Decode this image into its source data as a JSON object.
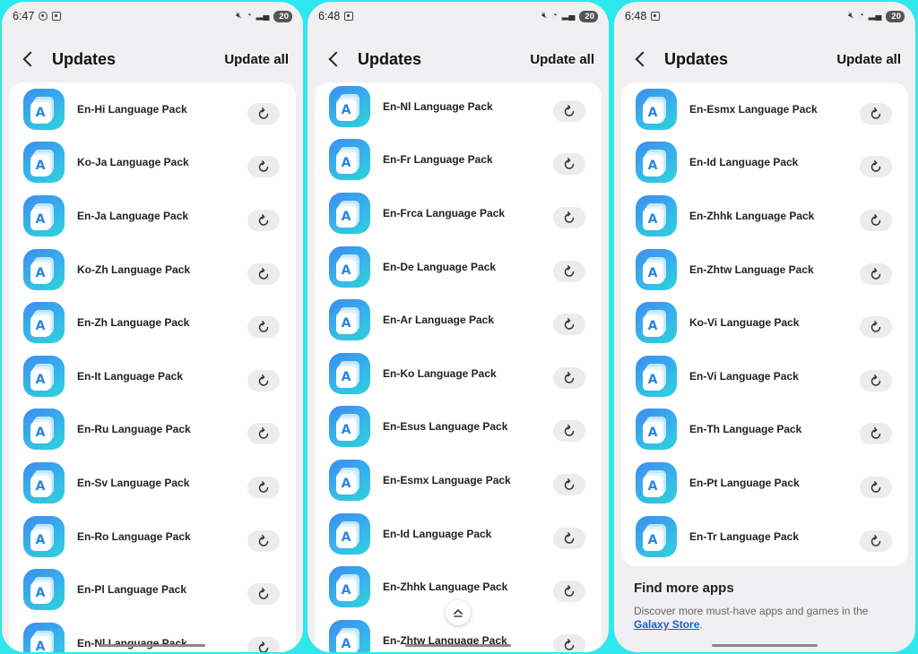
{
  "phones": [
    {
      "status": {
        "time": "6:47",
        "battery": "20"
      },
      "header": {
        "title": "Updates",
        "update_all": "Update all"
      },
      "items": [
        "En-Hi Language Pack",
        "Ko-Ja Language Pack",
        "En-Ja Language Pack",
        "Ko-Zh Language Pack",
        "En-Zh Language Pack",
        "En-It Language Pack",
        "En-Ru Language Pack",
        "En-Sv Language Pack",
        "En-Ro Language Pack",
        "En-Pl Language Pack",
        "En-Nl Language Pack"
      ]
    },
    {
      "status": {
        "time": "6:48",
        "battery": "20"
      },
      "header": {
        "title": "Updates",
        "update_all": "Update all"
      },
      "items": [
        "En-Nl Language Pack",
        "En-Fr Language Pack",
        "En-Frca Language Pack",
        "En-De Language Pack",
        "En-Ar Language Pack",
        "En-Ko Language Pack",
        "En-Esus Language Pack",
        "En-Esmx Language Pack",
        "En-Id Language Pack",
        "En-Zhhk Language Pack",
        "En-Zhtw Language Pack"
      ]
    },
    {
      "status": {
        "time": "6:48",
        "battery": "20"
      },
      "header": {
        "title": "Updates",
        "update_all": "Update all"
      },
      "items": [
        "En-Esmx Language Pack",
        "En-Id Language Pack",
        "En-Zhhk Language Pack",
        "En-Zhtw Language Pack",
        "Ko-Vi Language Pack",
        "En-Vi Language Pack",
        "En-Th Language Pack",
        "En-Pt Language Pack",
        "En-Tr Language Pack"
      ],
      "find_more": {
        "title": "Find more apps",
        "text": "Discover more must-have apps and games in the",
        "link": "Galaxy Store",
        "suffix": "."
      }
    }
  ],
  "app_icon_letter": "A",
  "colors": {
    "background": "#2ee8ee",
    "link": "#1a5fd0",
    "icon_start": "#3e8cf0",
    "icon_end": "#2ed3d7"
  },
  "icons": {
    "back": "chevron-left-icon",
    "update": "refresh-icon",
    "scroll_top": "chevron-up-icon"
  }
}
